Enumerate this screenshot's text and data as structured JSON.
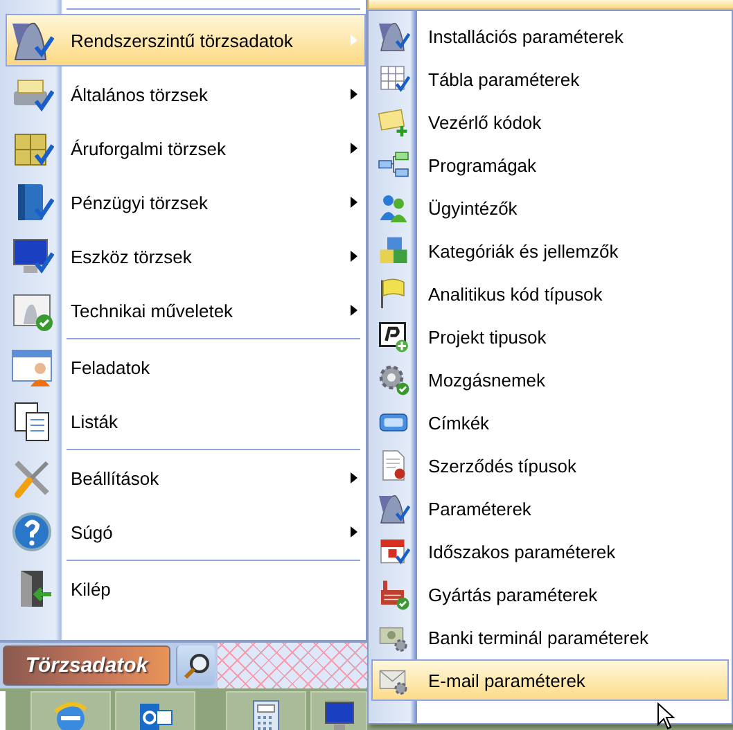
{
  "main_menu": {
    "groups": [
      {
        "items": [
          {
            "label": "Rendszerszintű törzsadatok",
            "has_submenu": true,
            "selected": true
          },
          {
            "label": "Általános törzsek",
            "has_submenu": true,
            "selected": false
          },
          {
            "label": "Áruforgalmi törzsek",
            "has_submenu": true,
            "selected": false
          },
          {
            "label": "Pénzügyi törzsek",
            "has_submenu": true,
            "selected": false
          },
          {
            "label": "Eszköz törzsek",
            "has_submenu": true,
            "selected": false
          },
          {
            "label": "Technikai műveletek",
            "has_submenu": true,
            "selected": false
          }
        ]
      },
      {
        "items": [
          {
            "label": "Feladatok",
            "has_submenu": false,
            "selected": false
          },
          {
            "label": "Listák",
            "has_submenu": false,
            "selected": false
          }
        ]
      },
      {
        "items": [
          {
            "label": "Beállítások",
            "has_submenu": true,
            "selected": false
          },
          {
            "label": "Súgó",
            "has_submenu": true,
            "selected": false
          }
        ]
      },
      {
        "items": [
          {
            "label": "Kilép",
            "has_submenu": false,
            "selected": false
          }
        ]
      }
    ]
  },
  "submenu": {
    "items": [
      {
        "label": "Installációs paraméterek",
        "selected": false
      },
      {
        "label": "Tábla paraméterek",
        "selected": false
      },
      {
        "label": "Vezérlő kódok",
        "selected": false
      },
      {
        "label": "Programágak",
        "selected": false
      },
      {
        "label": "Ügyintézők",
        "selected": false
      },
      {
        "label": "Kategóriák és jellemzők",
        "selected": false
      },
      {
        "label": "Analitikus kód típusok",
        "selected": false
      },
      {
        "label": "Projekt tipusok",
        "selected": false
      },
      {
        "label": "Mozgásnemek",
        "selected": false
      },
      {
        "label": "Címkék",
        "selected": false
      },
      {
        "label": "Szerződés típusok",
        "selected": false
      },
      {
        "label": "Paraméterek",
        "selected": false
      },
      {
        "label": "Időszakos paraméterek",
        "selected": false
      },
      {
        "label": "Gyártás paraméterek",
        "selected": false
      },
      {
        "label": "Banki terminál paraméterek",
        "selected": false
      },
      {
        "label": "E-mail paraméterek",
        "selected": true
      }
    ]
  },
  "bottom_bar": {
    "section_button": "Törzsadatok"
  }
}
